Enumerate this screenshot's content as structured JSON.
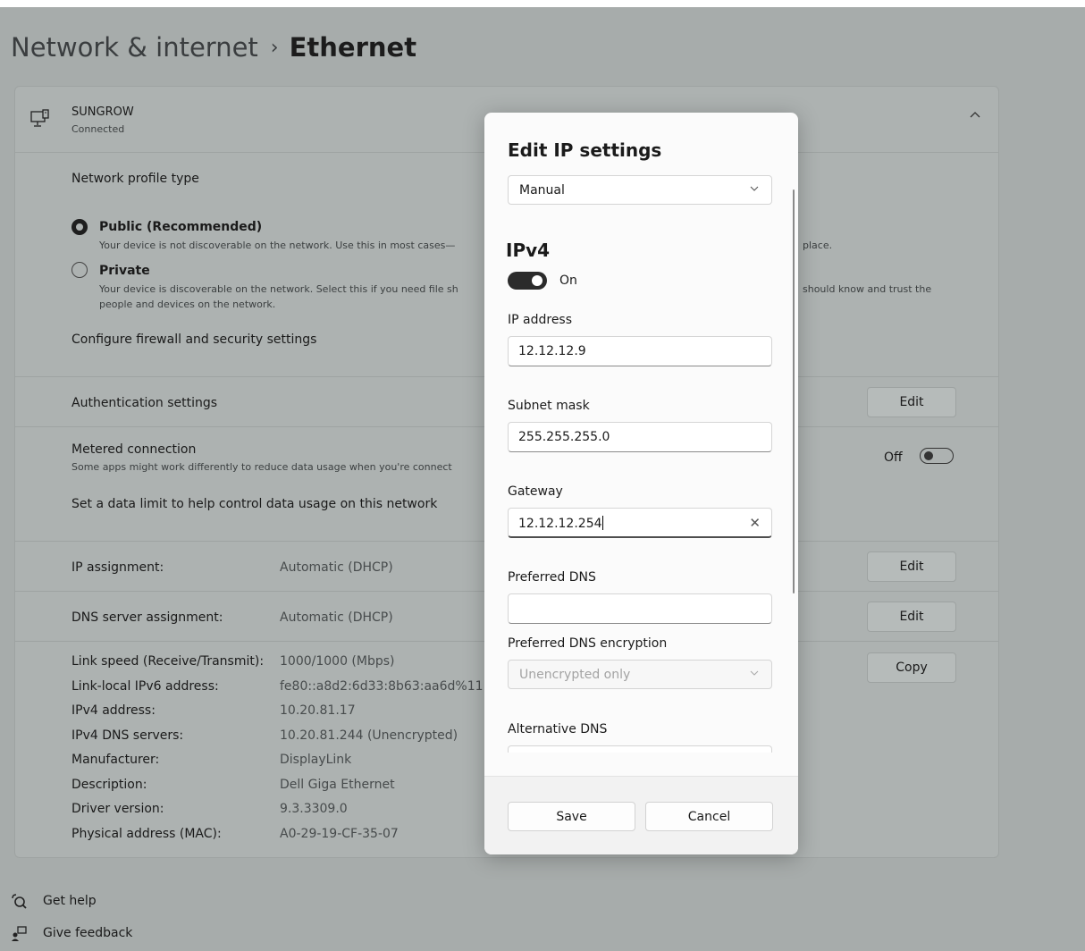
{
  "breadcrumb": {
    "parent": "Network & internet",
    "separator": "›",
    "current": "Ethernet"
  },
  "network": {
    "name": "SUNGROW",
    "status": "Connected"
  },
  "profile": {
    "heading": "Network profile type",
    "public_label": "Public (Recommended)",
    "public_desc": "Your device is not discoverable on the network. Use this in most cases—",
    "public_desc_tail": "place.",
    "private_label": "Private",
    "private_desc": "Your device is discoverable on the network. Select this if you need file sh",
    "private_desc_tail": "should know and trust the",
    "private_desc2": "people and devices on the network.",
    "firewall_link": "Configure firewall and security settings"
  },
  "auth": {
    "label": "Authentication settings",
    "button": "Edit"
  },
  "metered": {
    "label": "Metered connection",
    "desc": "Some apps might work differently to reduce data usage when you're connect",
    "toggle_label": "Off",
    "data_limit": "Set a data limit to help control data usage on this network"
  },
  "ip_assignment": {
    "label": "IP assignment:",
    "value": "Automatic (DHCP)",
    "button": "Edit"
  },
  "dns_assignment": {
    "label": "DNS server assignment:",
    "value": "Automatic (DHCP)",
    "button": "Edit"
  },
  "properties": {
    "copy_button": "Copy",
    "rows": [
      {
        "label": "Link speed (Receive/Transmit):",
        "value": "1000/1000 (Mbps)"
      },
      {
        "label": "Link-local IPv6 address:",
        "value": "fe80::a8d2:6d33:8b63:aa6d%11"
      },
      {
        "label": "IPv4 address:",
        "value": "10.20.81.17"
      },
      {
        "label": "IPv4 DNS servers:",
        "value": "10.20.81.244 (Unencrypted)"
      },
      {
        "label": "Manufacturer:",
        "value": "DisplayLink"
      },
      {
        "label": "Description:",
        "value": "Dell Giga Ethernet"
      },
      {
        "label": "Driver version:",
        "value": "9.3.3309.0"
      },
      {
        "label": "Physical address (MAC):",
        "value": "A0-29-19-CF-35-07"
      }
    ]
  },
  "footer_links": {
    "help": "Get help",
    "feedback": "Give feedback"
  },
  "dialog": {
    "title": "Edit IP settings",
    "mode": "Manual",
    "section": "IPv4",
    "toggle_label": "On",
    "ip_label": "IP address",
    "ip_value": "12.12.12.9",
    "subnet_label": "Subnet mask",
    "subnet_value": "255.255.255.0",
    "gateway_label": "Gateway",
    "gateway_value": "12.12.12.254",
    "pref_dns_label": "Preferred DNS",
    "pref_dns_value": "",
    "pref_dns_enc_label": "Preferred DNS encryption",
    "pref_dns_enc_value": "Unencrypted only",
    "alt_dns_label": "Alternative DNS",
    "save": "Save",
    "cancel": "Cancel"
  }
}
